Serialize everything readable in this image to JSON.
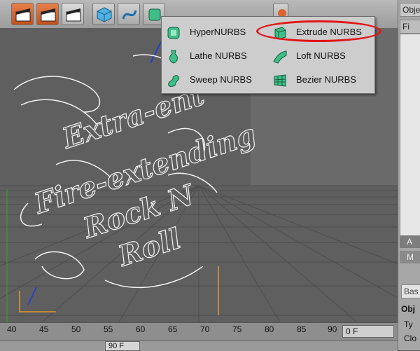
{
  "popup": {
    "items": [
      {
        "label": "HyperNURBS"
      },
      {
        "label": "Extrude NURBS"
      },
      {
        "label": "Lathe NURBS"
      },
      {
        "label": "Loft NURBS"
      },
      {
        "label": "Sweep NURBS"
      },
      {
        "label": "Bezier NURBS"
      }
    ]
  },
  "right_panel": {
    "tab1": "Obje",
    "tab2": "Fi",
    "dark1": "A",
    "dark2": "M",
    "input_basic": "Bas",
    "obj_header": "Obj",
    "ty": "Ty",
    "clo": "Clo"
  },
  "viewport_text": {
    "line1": "Extra-ent",
    "line2": "Fire-extending",
    "line3": "Rock N",
    "line4": "Roll"
  },
  "timeline": {
    "ticks": [
      "40",
      "45",
      "50",
      "55",
      "60",
      "65",
      "70",
      "75",
      "80",
      "85",
      "90"
    ],
    "frame": "0 F"
  },
  "bottom": {
    "field": "90 F"
  },
  "colors": {
    "accent": "#e21616",
    "toolbar_orange": "#d8652f",
    "nurbs_green": "#3fbe8a"
  }
}
